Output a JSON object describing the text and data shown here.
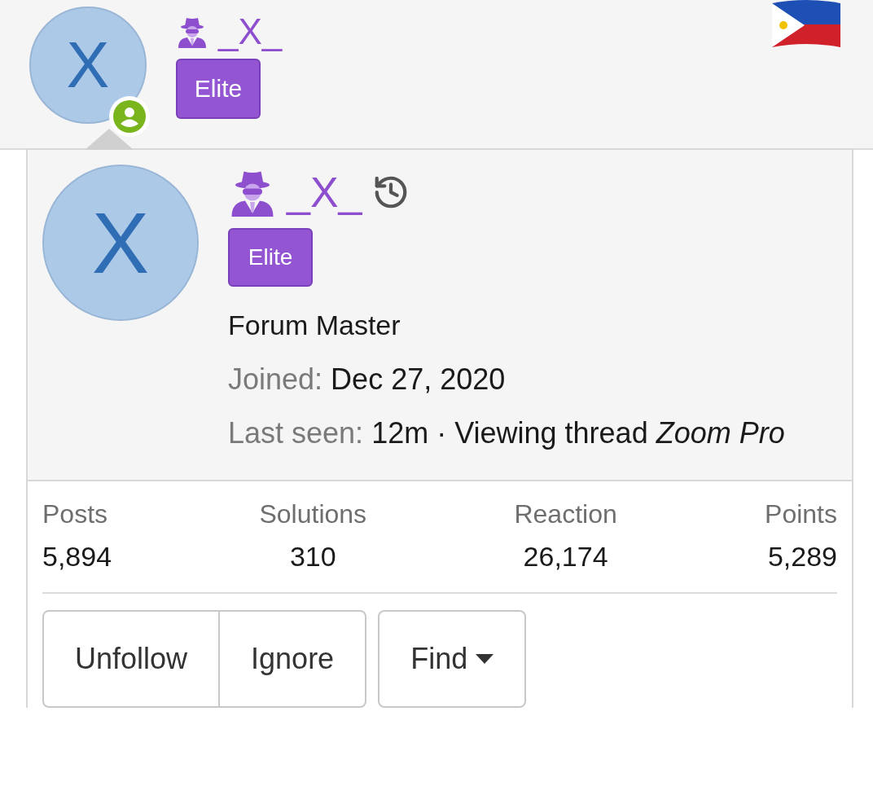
{
  "header": {
    "avatar_letter": "X",
    "online": true,
    "username": "_X_",
    "badge": "Elite"
  },
  "card": {
    "avatar_letter": "X",
    "username": "_X_",
    "badge": "Elite",
    "user_title": "Forum Master",
    "details": [
      {
        "label": "Joined:",
        "value": "Dec 27, 2020"
      },
      {
        "label": "Last seen:",
        "value": "12m · Viewing thread *Zoom Pro*"
      }
    ],
    "stats": [
      {
        "label": "Posts",
        "value": "5,894"
      },
      {
        "label": "Solutions",
        "value": "310"
      },
      {
        "label": "Reaction",
        "value": "26,174"
      },
      {
        "label": "Points",
        "value": "5,289"
      }
    ],
    "button_group": [
      "Unfollow",
      "Ignore"
    ],
    "menu_button": "Find"
  }
}
